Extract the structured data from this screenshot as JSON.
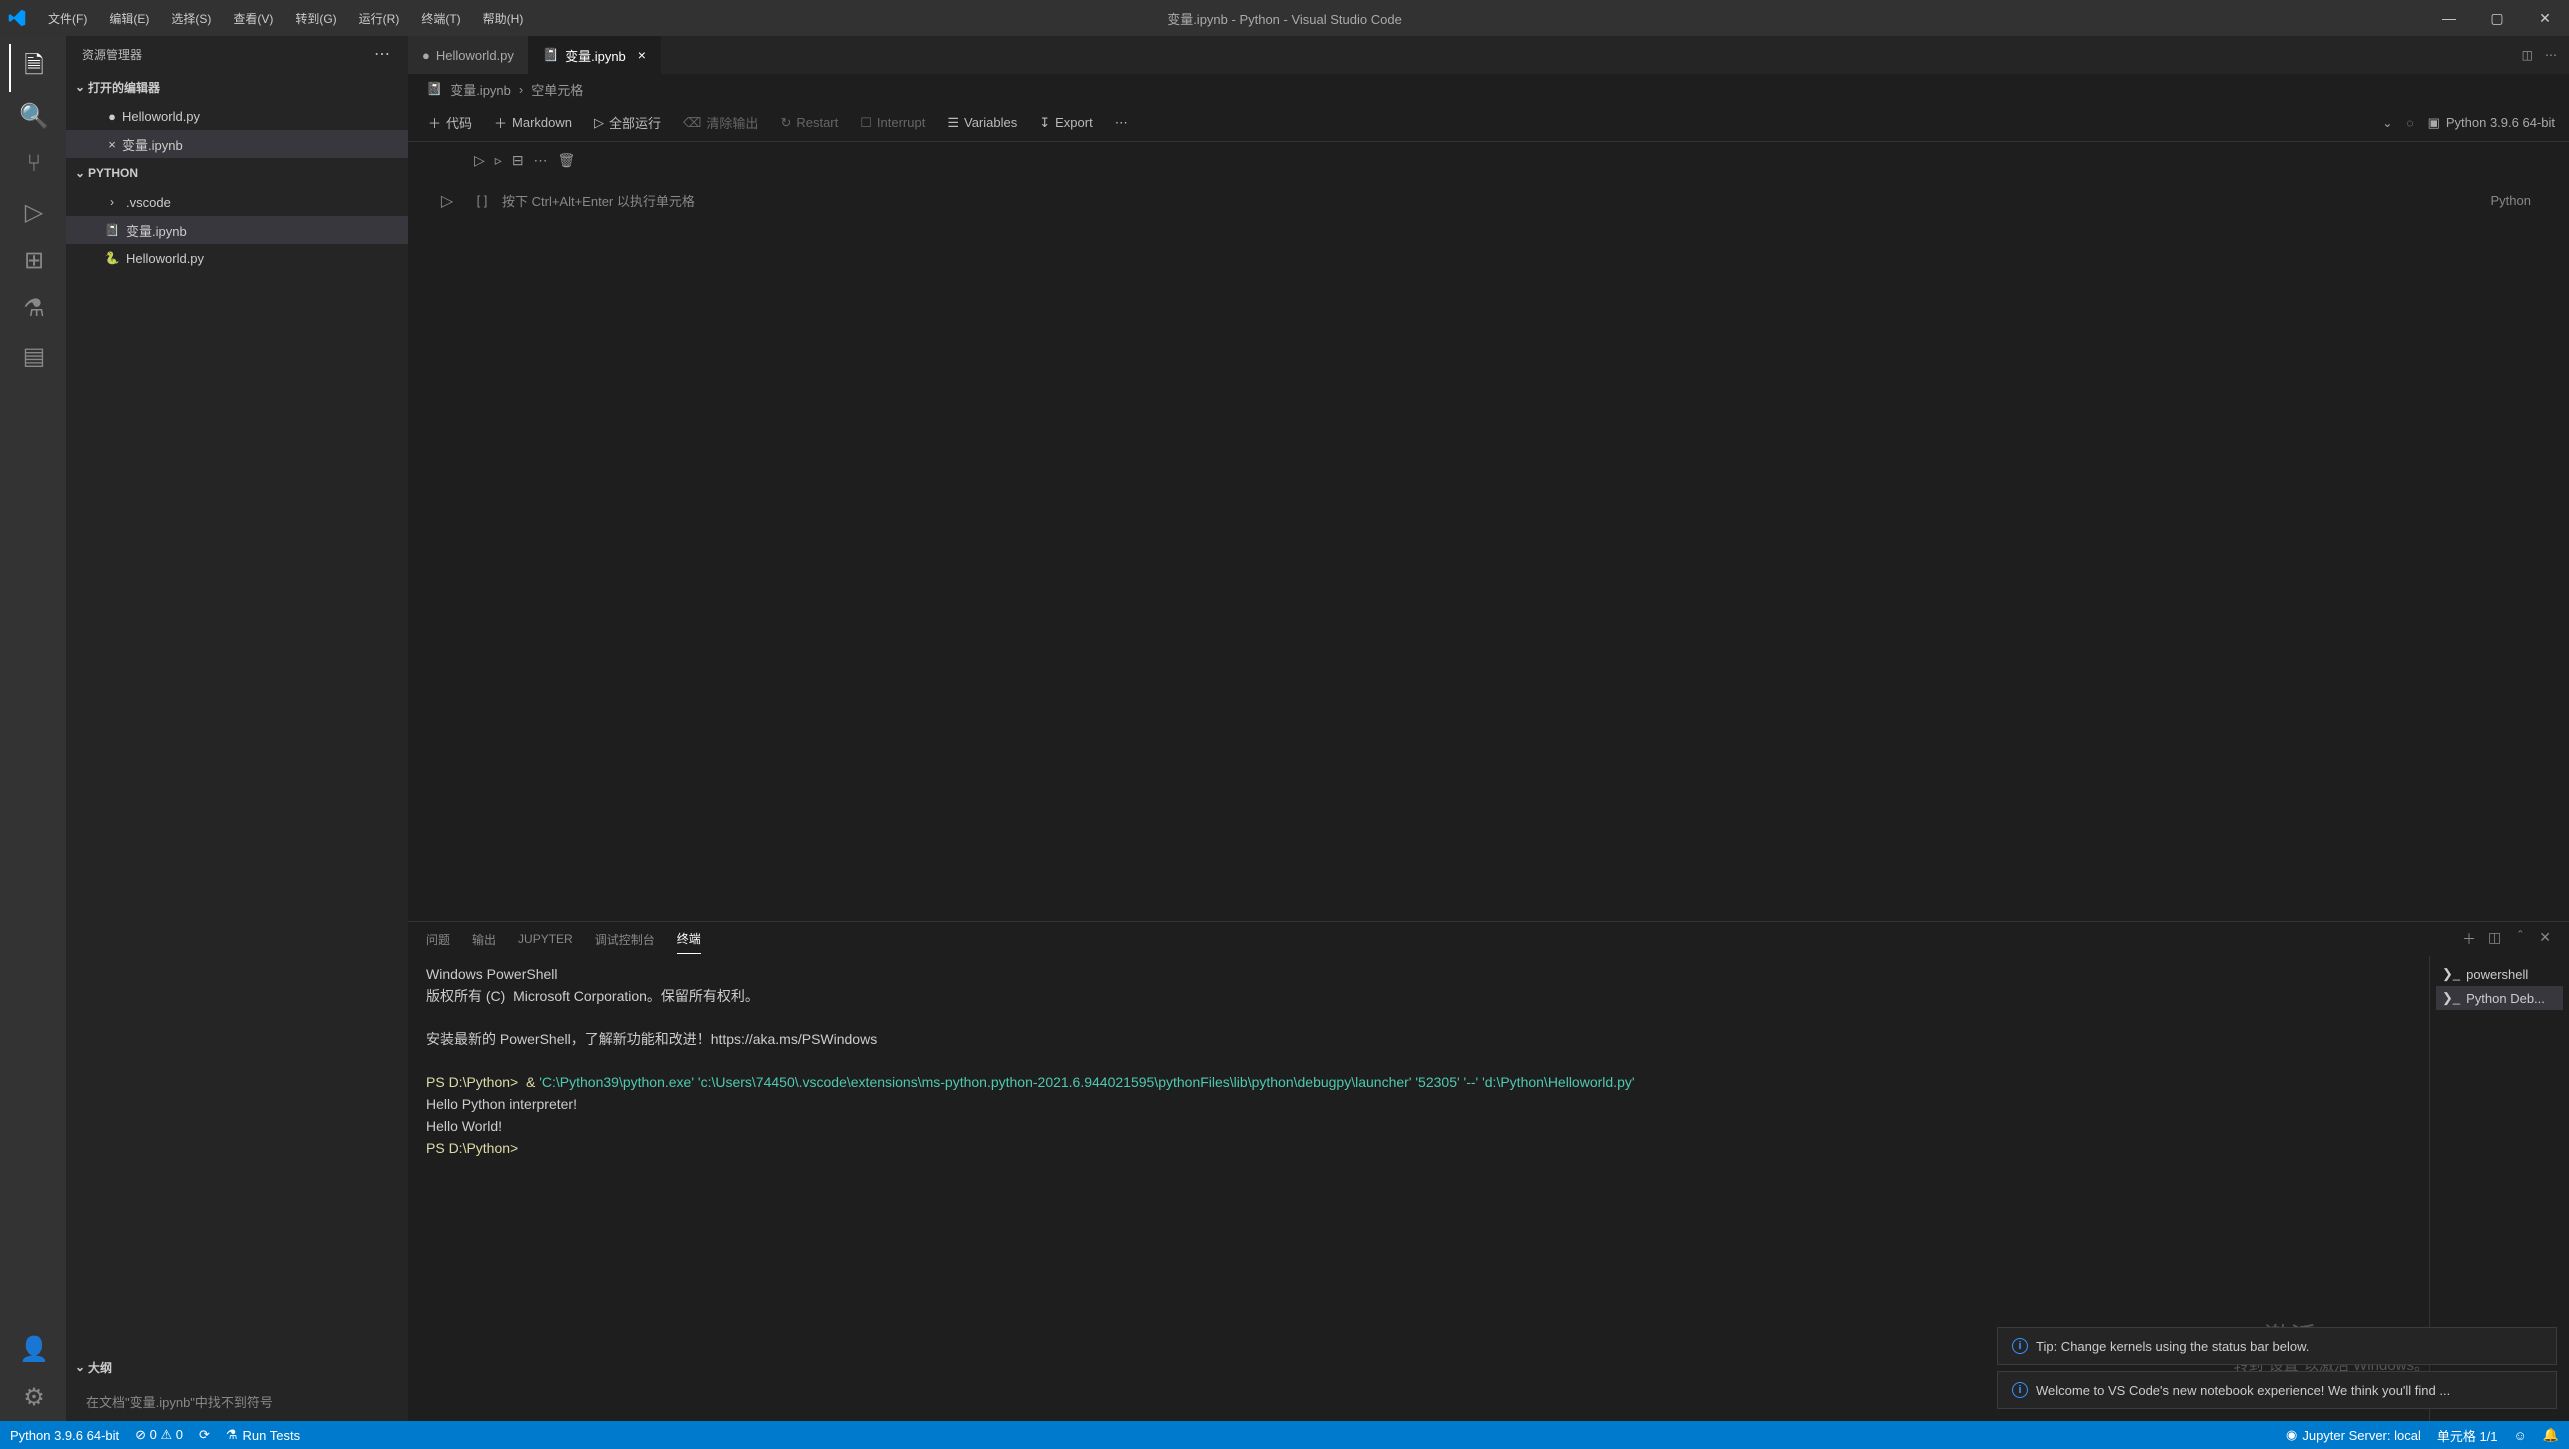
{
  "title": "变量.ipynb - Python - Visual Studio Code",
  "menu": [
    "文件(F)",
    "编辑(E)",
    "选择(S)",
    "查看(V)",
    "转到(G)",
    "运行(R)",
    "终端(T)",
    "帮助(H)"
  ],
  "sidebar": {
    "title": "资源管理器",
    "section_open": "打开的编辑器",
    "open_editors": [
      {
        "icon": "●",
        "name": "Helloworld.py"
      },
      {
        "icon": "×",
        "name": "变量.ipynb"
      }
    ],
    "project": "PYTHON",
    "tree": [
      {
        "chev": "›",
        "name": ".vscode",
        "indent": 1
      },
      {
        "chev": "",
        "name": "变量.ipynb",
        "indent": 1,
        "selected": true
      },
      {
        "chev": "",
        "name": "Helloworld.py",
        "indent": 1
      }
    ],
    "outline_title": "大纲",
    "outline_msg": "在文档\"变量.ipynb\"中找不到符号"
  },
  "tabs": [
    {
      "icon": "●",
      "name": "Helloworld.py",
      "active": false
    },
    {
      "icon": "",
      "name": "变量.ipynb",
      "active": true,
      "close": "×"
    }
  ],
  "breadcrumb": [
    "变量.ipynb",
    "空单元格"
  ],
  "nbtoolbar": {
    "code": "代码",
    "markdown": "Markdown",
    "runall": "全部运行",
    "clear": "清除输出",
    "restart": "Restart",
    "interrupt": "Interrupt",
    "variables": "Variables",
    "export": "Export"
  },
  "kernel": {
    "label": "Python 3.9.6 64-bit"
  },
  "cell": {
    "placeholder": "按下 Ctrl+Alt+Enter 以执行单元格",
    "lang": "Python",
    "bracket": "[ ]"
  },
  "panel": {
    "tabs": [
      "问题",
      "输出",
      "JUPYTER",
      "调试控制台",
      "终端"
    ],
    "active": 4,
    "terminals": [
      {
        "name": "powershell"
      },
      {
        "name": "Python Deb..."
      }
    ]
  },
  "terminal_lines": {
    "l1": "Windows PowerShell",
    "l2": "版权所有 (C)  Microsoft Corporation。保留所有权利。",
    "l3": "安装最新的 PowerShell，了解新功能和改进！https://aka.ms/PSWindows",
    "prompt": "PS D:\\Python>  & ",
    "cmd": "'C:\\Python39\\python.exe' 'c:\\Users\\74450\\.vscode\\extensions\\ms-python.python-2021.6.944021595\\pythonFiles\\lib\\python\\debugpy\\launcher' '52305' '--' 'd:\\Python\\Helloworld.py'",
    "out1": "Hello Python interpreter!",
    "out2": "Hello World!",
    "prompt2": "PS D:\\Python> "
  },
  "notifications": [
    "Tip: Change kernels using the status bar below.",
    "Welcome to VS Code's new notebook experience! We think you'll find ..."
  ],
  "watermark": {
    "l1": "激活 Windows",
    "l2": "转到\"设置\"以激活 Windows。"
  },
  "statusbar": {
    "python": "Python 3.9.6 64-bit",
    "errors": "⊘ 0  ⚠ 0",
    "runtests": "Run Tests",
    "jupyter": "Jupyter Server: local",
    "cells": "单元格 1/1"
  }
}
